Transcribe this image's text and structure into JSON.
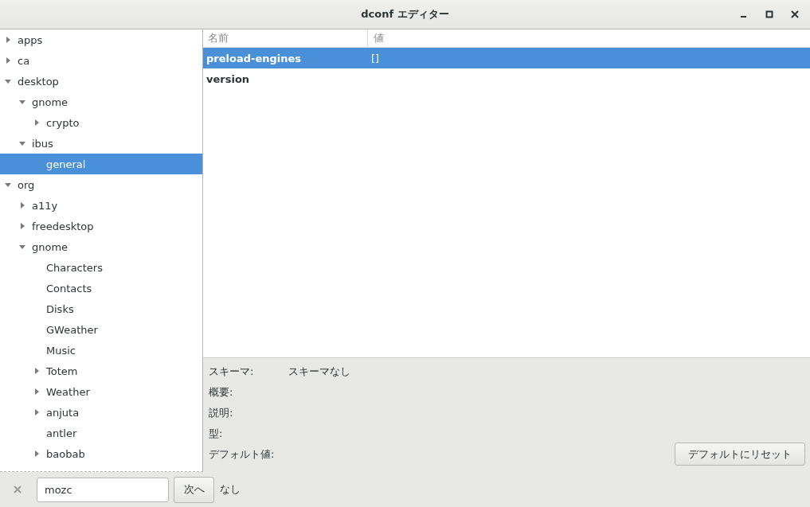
{
  "window": {
    "title": "dconf エディター"
  },
  "tree": [
    {
      "label": "apps",
      "kind": "branch",
      "expanded": false,
      "selected": false
    },
    {
      "label": "ca",
      "kind": "branch",
      "expanded": false,
      "selected": false
    },
    {
      "label": "desktop",
      "kind": "branch",
      "expanded": true,
      "selected": false,
      "children": [
        {
          "label": "gnome",
          "kind": "branch",
          "expanded": true,
          "selected": false,
          "children": [
            {
              "label": "crypto",
              "kind": "branch",
              "expanded": false,
              "selected": false
            }
          ]
        },
        {
          "label": "ibus",
          "kind": "branch",
          "expanded": true,
          "selected": false,
          "children": [
            {
              "label": "general",
              "kind": "leaf",
              "selected": true
            }
          ]
        }
      ]
    },
    {
      "label": "org",
      "kind": "branch",
      "expanded": true,
      "selected": false,
      "children": [
        {
          "label": "a11y",
          "kind": "branch",
          "expanded": false,
          "selected": false
        },
        {
          "label": "freedesktop",
          "kind": "branch",
          "expanded": false,
          "selected": false
        },
        {
          "label": "gnome",
          "kind": "branch",
          "expanded": true,
          "selected": false,
          "children": [
            {
              "label": "Characters",
              "kind": "leaf",
              "selected": false
            },
            {
              "label": "Contacts",
              "kind": "leaf",
              "selected": false
            },
            {
              "label": "Disks",
              "kind": "leaf",
              "selected": false
            },
            {
              "label": "GWeather",
              "kind": "leaf",
              "selected": false
            },
            {
              "label": "Music",
              "kind": "leaf",
              "selected": false
            },
            {
              "label": "Totem",
              "kind": "branch",
              "expanded": false,
              "selected": false
            },
            {
              "label": "Weather",
              "kind": "branch",
              "expanded": false,
              "selected": false
            },
            {
              "label": "anjuta",
              "kind": "branch",
              "expanded": false,
              "selected": false
            },
            {
              "label": "antler",
              "kind": "leaf",
              "selected": false
            },
            {
              "label": "baobab",
              "kind": "branch",
              "expanded": false,
              "selected": false
            }
          ]
        }
      ]
    }
  ],
  "table": {
    "columns": [
      "名前",
      "値"
    ],
    "rows": [
      {
        "name": "preload-engines",
        "value": "[]",
        "selected": true
      },
      {
        "name": "version",
        "value": "",
        "selected": false
      }
    ]
  },
  "details": {
    "fields": [
      {
        "label": "スキーマ:",
        "value": "スキーマなし"
      },
      {
        "label": "概要:"
      },
      {
        "label": "説明:"
      },
      {
        "label": "型:"
      },
      {
        "label": "デフォルト値:"
      }
    ],
    "reset_button": "デフォルトにリセット"
  },
  "search_bar": {
    "value": "mozc",
    "next_button": "次へ",
    "result": "なし"
  }
}
